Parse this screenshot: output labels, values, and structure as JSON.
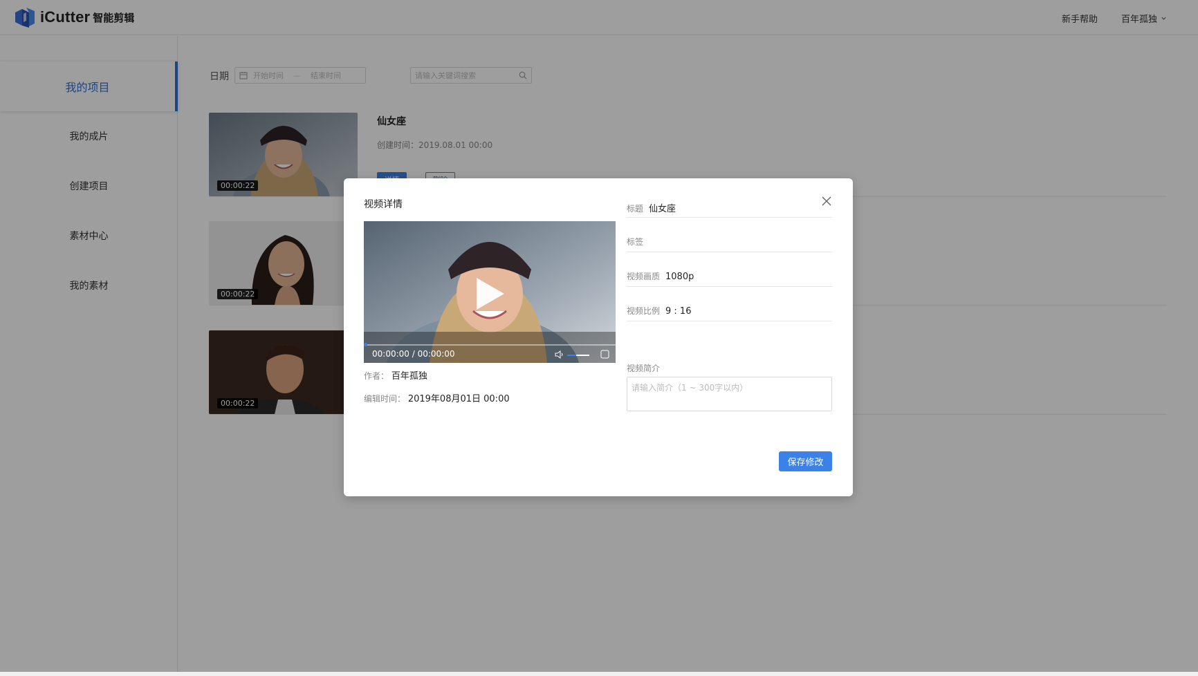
{
  "header": {
    "logo_text": "iCutter",
    "logo_sub": "智能剪辑",
    "help_label": "新手帮助",
    "user_name": "百年孤独"
  },
  "sidebar": {
    "items": [
      {
        "label": "我的项目",
        "active": true
      },
      {
        "label": "我的成片"
      },
      {
        "label": "创建项目"
      },
      {
        "label": "素材中心"
      },
      {
        "label": "我的素材"
      }
    ]
  },
  "filter": {
    "date_label": "日期",
    "start_placeholder": "开始时间",
    "date_separator": "—",
    "end_placeholder": "结束时间",
    "search_placeholder": "请输入关键词搜索"
  },
  "projects": [
    {
      "title": "仙女座",
      "created": "创建时间：2019.08.01 00:00",
      "duration": "00:00:22",
      "detail_label": "详情",
      "delete_label": "删除"
    },
    {
      "duration": "00:00:22"
    },
    {
      "duration": "00:00:22"
    }
  ],
  "modal": {
    "title": "视频详情",
    "player": {
      "current_time": "00:00:00",
      "separator": "/",
      "total_time": "00:00:00",
      "progress": 0,
      "volume": 0.4
    },
    "author_label": "作者：",
    "author": "百年孤独",
    "edit_time_label": "编辑时间：",
    "edit_time": "2019年08月01日 00:00",
    "fields": {
      "title_label": "标题",
      "title_value": "仙女座",
      "tags_label": "标签",
      "tags_value": "",
      "quality_label": "视频画质",
      "quality_value": "1080p",
      "ratio_label": "视频比例",
      "ratio_value": "9 : 16",
      "intro_label": "视频简介",
      "intro_placeholder": "请输入简介（1 ~ 300字以内）"
    },
    "save_label": "保存修改"
  },
  "colors": {
    "accent": "#3b82e8",
    "overlay": "rgba(0,0,0,0.38)"
  }
}
